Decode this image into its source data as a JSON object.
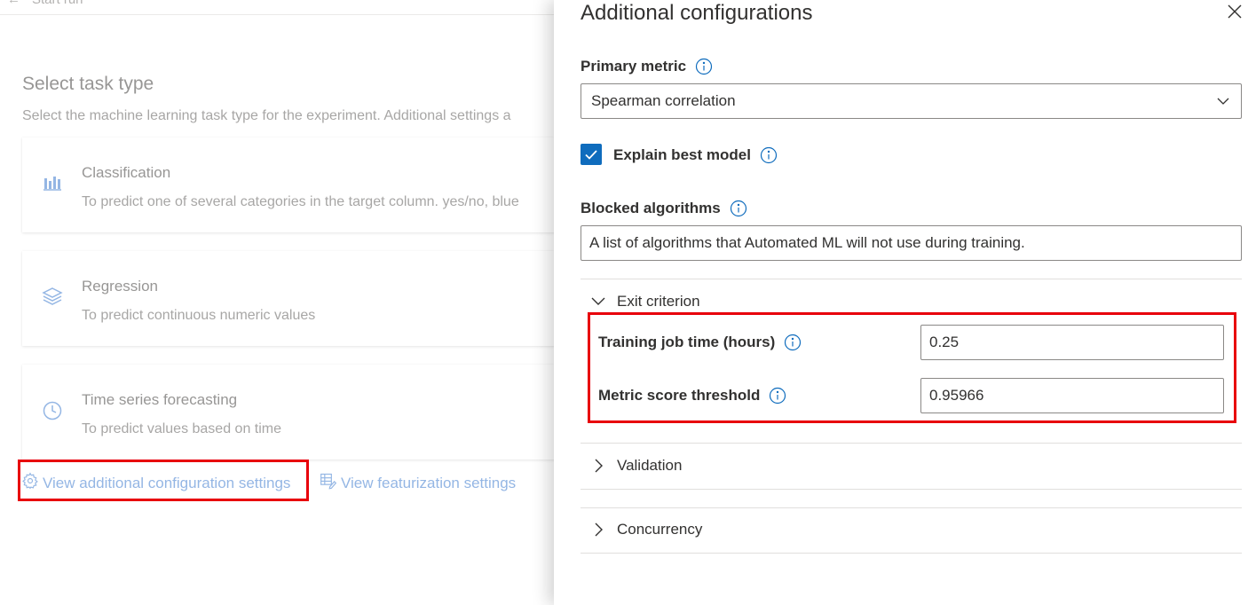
{
  "background_page": {
    "breadcrumb": "Start run",
    "section_title": "Select task type",
    "section_description": "Select the machine learning task type for the experiment. Additional settings a",
    "task_types": [
      {
        "title": "Classification",
        "description": "To predict one of several categories in the target column. yes/no, blue",
        "icon": "bar-chart-icon"
      },
      {
        "title": "Regression",
        "description": "To predict continuous numeric values",
        "icon": "layers-icon"
      },
      {
        "title": "Time series forecasting",
        "description": "To predict values based on time",
        "icon": "clock-icon"
      }
    ],
    "links": {
      "additional_config": "View additional configuration settings",
      "featurization": "View featurization settings"
    }
  },
  "panel": {
    "title": "Additional configurations",
    "primary_metric": {
      "label": "Primary metric",
      "value": "Spearman correlation"
    },
    "explain_best_model": {
      "label": "Explain best model",
      "checked": true
    },
    "blocked_algorithms": {
      "label": "Blocked algorithms",
      "placeholder": "A list of algorithms that Automated ML will not use during training."
    },
    "exit_criterion": {
      "label": "Exit criterion",
      "expanded": true,
      "training_job_time": {
        "label": "Training job time (hours)",
        "value": "0.25"
      },
      "metric_score_threshold": {
        "label": "Metric score threshold",
        "value": "0.95966"
      }
    },
    "validation": {
      "label": "Validation",
      "expanded": false
    },
    "concurrency": {
      "label": "Concurrency",
      "expanded": false
    }
  },
  "colors": {
    "accent": "#0f6cbd",
    "link": "#5b8fd6",
    "highlight": "#e8000b"
  }
}
